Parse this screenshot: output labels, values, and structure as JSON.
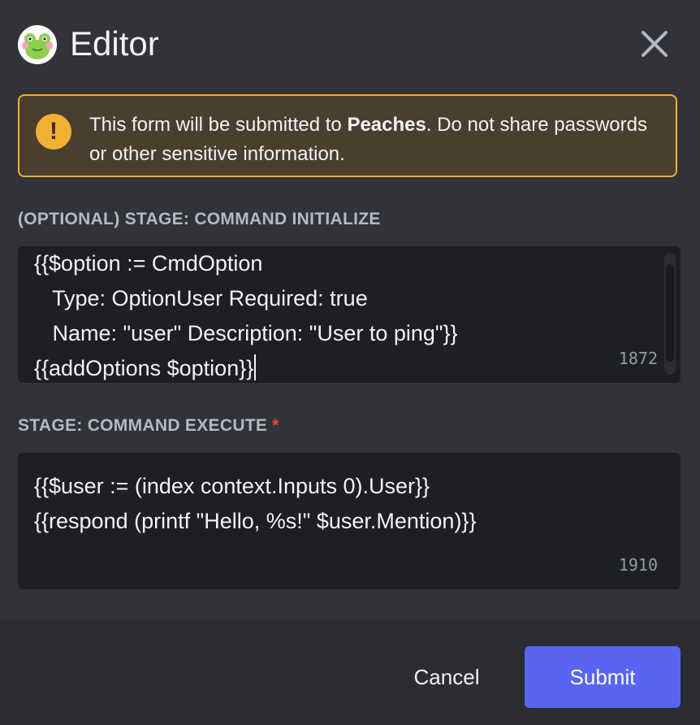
{
  "header": {
    "title": "Editor",
    "avatar_icon": "frog-avatar-icon",
    "close_icon": "close-icon"
  },
  "notice": {
    "icon": "exclamation-icon",
    "text_before": "This form will be submitted to ",
    "app_name": "Peaches",
    "text_after": ". Do not share passwords or other sensitive information.",
    "accent_color": "#f0b132"
  },
  "fields": [
    {
      "label": "(OPTIONAL) STAGE: COMMAND INITIALIZE",
      "required": false,
      "lines": [
        "{{$option := CmdOption",
        "   Type: OptionUser Required: true",
        "   Name: \"user\" Description: \"User to ping\"}}",
        "{{addOptions $option}}"
      ],
      "remaining": "1872"
    },
    {
      "label": "STAGE: COMMAND EXECUTE",
      "required": true,
      "required_marker": "*",
      "lines": [
        "{{$user := (index context.Inputs 0).User}}",
        "{{respond (printf \"Hello, %s!\" $user.Mention)}}"
      ],
      "remaining": "1910"
    }
  ],
  "footer": {
    "cancel_label": "Cancel",
    "submit_label": "Submit",
    "submit_color": "#5865f2"
  }
}
